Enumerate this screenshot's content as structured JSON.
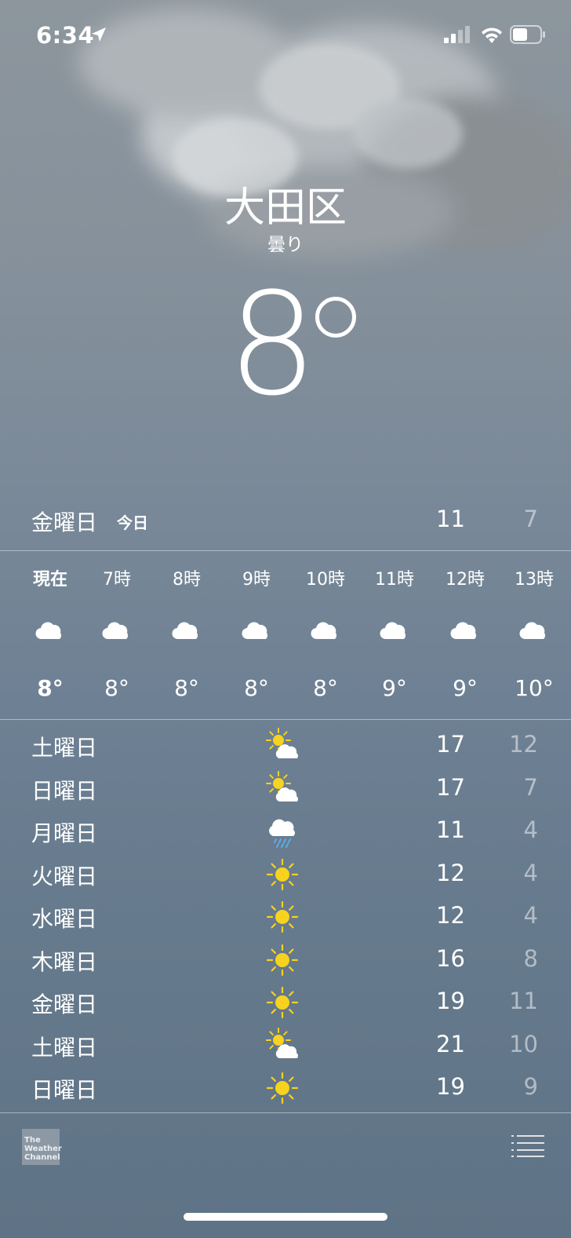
{
  "status_bar": {
    "time": "6:34"
  },
  "location": {
    "city": "大田区",
    "condition": "曇り",
    "temperature": "8"
  },
  "today": {
    "day": "金曜日",
    "tag": "今日",
    "high": "11",
    "low": "7"
  },
  "hourly": [
    {
      "label": "現在",
      "temp": "8°",
      "icon": "cloud-icon"
    },
    {
      "label": "7時",
      "temp": "8°",
      "icon": "cloud-icon"
    },
    {
      "label": "8時",
      "temp": "8°",
      "icon": "cloud-icon"
    },
    {
      "label": "9時",
      "temp": "8°",
      "icon": "cloud-icon"
    },
    {
      "label": "10時",
      "temp": "8°",
      "icon": "cloud-icon"
    },
    {
      "label": "11時",
      "temp": "9°",
      "icon": "cloud-icon"
    },
    {
      "label": "12時",
      "temp": "9°",
      "icon": "cloud-icon"
    },
    {
      "label": "13時",
      "temp": "10°",
      "icon": "cloud-icon"
    }
  ],
  "daily": [
    {
      "day": "土曜日",
      "icon": "partly-cloudy-icon",
      "high": "17",
      "low": "12"
    },
    {
      "day": "日曜日",
      "icon": "partly-cloudy-icon",
      "high": "17",
      "low": "7"
    },
    {
      "day": "月曜日",
      "icon": "rain-icon",
      "high": "11",
      "low": "4"
    },
    {
      "day": "火曜日",
      "icon": "sun-icon",
      "high": "12",
      "low": "4"
    },
    {
      "day": "水曜日",
      "icon": "sun-icon",
      "high": "12",
      "low": "4"
    },
    {
      "day": "木曜日",
      "icon": "sun-icon",
      "high": "16",
      "low": "8"
    },
    {
      "day": "金曜日",
      "icon": "sun-icon",
      "high": "19",
      "low": "11"
    },
    {
      "day": "土曜日",
      "icon": "partly-cloudy-icon",
      "high": "21",
      "low": "10"
    },
    {
      "day": "日曜日",
      "icon": "sun-icon",
      "high": "19",
      "low": "9"
    }
  ],
  "footer": {
    "logo_line1": "The",
    "logo_line2": "Weather",
    "logo_line3": "Channel"
  },
  "colors": {
    "sun": "#f7d21e",
    "rain": "#5aaee6",
    "cloud": "#ffffff"
  }
}
